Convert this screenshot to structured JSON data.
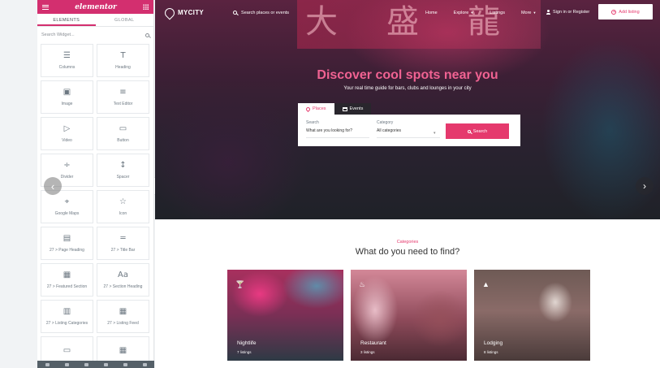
{
  "editor": {
    "brand": "elementor",
    "tabs": [
      "ELEMENTS",
      "GLOBAL"
    ],
    "search_placeholder": "Search Widget...",
    "widgets": [
      {
        "label": "Columns",
        "icon": "columns-icon",
        "glyph": "☰"
      },
      {
        "label": "Heading",
        "icon": "heading-icon",
        "glyph": "T"
      },
      {
        "label": "Image",
        "icon": "image-icon",
        "glyph": "▣"
      },
      {
        "label": "Text Editor",
        "icon": "text-editor-icon",
        "glyph": "≡"
      },
      {
        "label": "Video",
        "icon": "video-icon",
        "glyph": "▷"
      },
      {
        "label": "Button",
        "icon": "button-icon",
        "glyph": "▭"
      },
      {
        "label": "Divider",
        "icon": "divider-icon",
        "glyph": "÷"
      },
      {
        "label": "Spacer",
        "icon": "spacer-icon",
        "glyph": "↕"
      },
      {
        "label": "Google Maps",
        "icon": "google-maps-icon",
        "glyph": "⌖"
      },
      {
        "label": "Icon",
        "icon": "icon-widget-icon",
        "glyph": "☆"
      },
      {
        "label": "27 > Page Heading",
        "icon": "page-heading-icon",
        "glyph": "▤"
      },
      {
        "label": "27 > Title Bar",
        "icon": "title-bar-icon",
        "glyph": "═"
      },
      {
        "label": "27 > Featured Section",
        "icon": "featured-section-icon",
        "glyph": "▦"
      },
      {
        "label": "27 > Section Heading",
        "icon": "section-heading-icon",
        "glyph": "Aa"
      },
      {
        "label": "27 > Listing Categories",
        "icon": "listing-categories-icon",
        "glyph": "▥"
      },
      {
        "label": "27 > Listing Feed",
        "icon": "listing-feed-icon",
        "glyph": "▦"
      },
      {
        "label": "",
        "icon": "widget-icon",
        "glyph": "▭"
      },
      {
        "label": "",
        "icon": "widget-icon",
        "glyph": "▦"
      }
    ]
  },
  "site": {
    "logo": "MYCITY",
    "search_text": "Search places or events",
    "nav": [
      "Home",
      "Explore",
      "Listings",
      "More"
    ],
    "signin": "Sign in or Register",
    "add_listing": "Add listing",
    "hero_title": "Discover cool spots near you",
    "hero_subtitle": "Your real time guide for bars, clubs and lounges in your city",
    "search_tabs": [
      "Places",
      "Events"
    ],
    "search_label": "Search",
    "search_value": "What are you looking for?",
    "category_label": "Category",
    "category_value": "All categories",
    "search_button": "Search",
    "categories_kicker": "Categories",
    "categories_title": "What do you need to find?",
    "cards": [
      {
        "name": "Nightlife",
        "count": "7 listings",
        "icon": "cocktail-icon",
        "glyph": "🍸"
      },
      {
        "name": "Restaurant",
        "count": "3 listings",
        "icon": "chef-hat-icon",
        "glyph": "♨"
      },
      {
        "name": "Lodging",
        "count": "8 listings",
        "icon": "lodging-icon",
        "glyph": "▲"
      }
    ]
  },
  "colors": {
    "brand": "#d32f6f",
    "accent": "#e5396d",
    "hero_title": "#f06292"
  }
}
